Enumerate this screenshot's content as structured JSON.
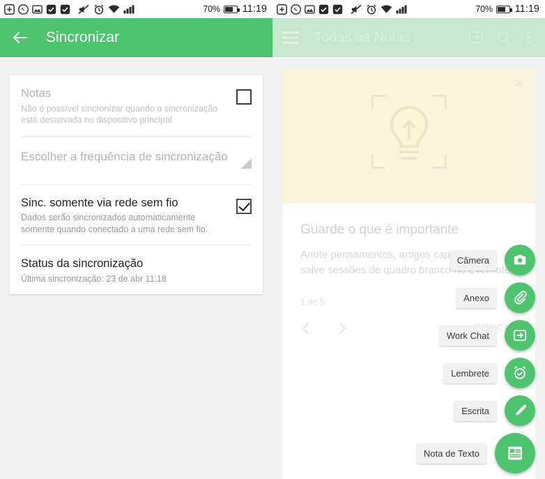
{
  "status_bar": {
    "icons": [
      "add-box-icon",
      "whatsapp-icon",
      "photo-icon",
      "check-box-icon",
      "check-box-icon",
      "mute-icon",
      "alarm-icon",
      "wifi-icon",
      "signal-icon"
    ],
    "battery_percent": "70%",
    "clock": "11:19"
  },
  "left_screen": {
    "appbar": {
      "back_icon": "back-arrow-icon",
      "title": "Sincronizar",
      "bg": "#4ec46f"
    },
    "rows": [
      {
        "title": "Notas",
        "subtitle": "Não é possível sincronizar quando a sincronização está desativada no dispositivo principal",
        "control": "checkbox",
        "checked": false,
        "dim": true
      },
      {
        "title": "Escolher a frequência de sincronização",
        "subtitle": "",
        "control": "triangle",
        "dim": true
      },
      {
        "title": "Sinc. somente via rede sem fio",
        "subtitle": "Dados serão sincronizados automaticamente somente quando conectado a uma rede sem fio.",
        "control": "checkbox",
        "checked": true,
        "dim": false
      },
      {
        "title": "Status da sincronização",
        "subtitle": "Última sincronização: 23 de abr 11:18",
        "control": "none",
        "dim": false
      }
    ]
  },
  "right_screen": {
    "appbar": {
      "menu_icon": "hamburger-icon",
      "title": "Todas as Notas",
      "icons": [
        "work-chat-icon",
        "search-icon",
        "overflow-menu-icon"
      ],
      "bg": "#c7e6cf"
    },
    "banner": {
      "close_icon": "close-icon",
      "illustration": "lightbulb-icon",
      "bg": "#fbf4da"
    },
    "promo": {
      "title": "Guarde o que é importante",
      "description": "Anote pensamentos, artigos capturados e salve sessões de quadro branco no Evernote.",
      "pager": "1 de 5",
      "prev_icon": "chevron-left-icon",
      "next_icon": "chevron-right-icon",
      "advance_label": "AVANÇAR"
    },
    "fabs": [
      {
        "label": "Câmera",
        "icon": "camera-icon"
      },
      {
        "label": "Anexo",
        "icon": "paperclip-icon"
      },
      {
        "label": "Work Chat",
        "icon": "work-chat-icon"
      },
      {
        "label": "Lembrete",
        "icon": "alarm-clock-icon"
      },
      {
        "label": "Escrita",
        "icon": "pen-icon"
      },
      {
        "label": "Nota de Texto",
        "icon": "text-note-icon"
      }
    ],
    "accent": "#4ec46f"
  }
}
